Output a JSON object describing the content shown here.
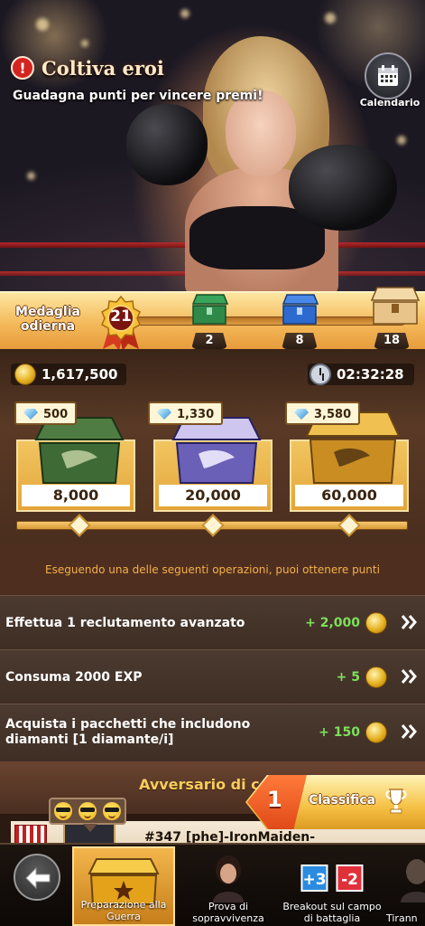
{
  "hero": {
    "title": "Coltiva eroi",
    "subtitle": "Guadagna punti per vincere premi!",
    "calendar_label": "Calendario"
  },
  "medal_bar": {
    "label": "Medaglia odierna",
    "today_medal": "21",
    "milestones": [
      "2",
      "8",
      "18"
    ]
  },
  "resources": {
    "coins": "1,617,500",
    "timer": "02:32:28"
  },
  "chests": [
    {
      "gems": "500",
      "points": "8,000",
      "color": "#3f6a34"
    },
    {
      "gems": "1,330",
      "points": "20,000",
      "color": "#6a5fb0"
    },
    {
      "gems": "3,580",
      "points": "60,000",
      "color": "#c98d22"
    }
  ],
  "info_text": "Eseguendo una delle seguenti operazioni, puoi ottenere punti",
  "tasks": [
    {
      "name": "Effettua 1 reclutamento avanzato",
      "points": "+ 2,000"
    },
    {
      "name": "Consuma 2000 EXP",
      "points": "+ 5"
    },
    {
      "name": "Acquista i pacchetti che includono diamanti [1 diamante/i]",
      "points": "+ 150"
    }
  ],
  "opponent": {
    "title": "Avversario di c",
    "name": "#347 [phe]-IronMaiden-"
  },
  "ranking": {
    "position": "1",
    "label": "Classifica"
  },
  "bottom_nav": [
    {
      "label": "Preparazione alla Guerra",
      "active": true
    },
    {
      "label": "Prova di sopravvivenza",
      "active": false
    },
    {
      "label": "Breakout sul campo di battaglia",
      "active": false
    },
    {
      "label": "Tirann",
      "active": false
    }
  ],
  "breakout_score": {
    "left": "+3",
    "right": "-2"
  },
  "colors": {
    "accent_gold": "#f4b95a",
    "points_green": "#7de05a",
    "info_orange": "#f3b04b"
  }
}
